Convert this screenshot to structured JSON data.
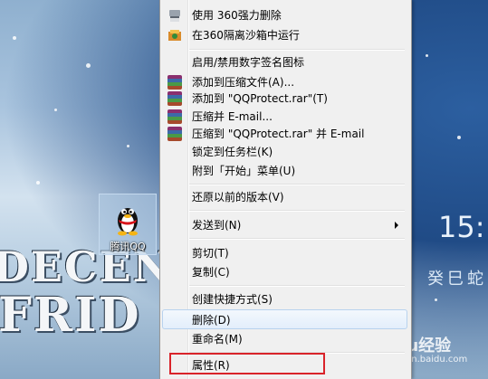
{
  "desktop": {
    "icon_label": "腾讯QQ",
    "banner_line1": "DECEN",
    "banner_line2": "FRID",
    "clock_text": "15:",
    "date_text": "癸巳蛇",
    "watermark": "Baidu经验",
    "watermark_sub": "jingyan.baidu.com"
  },
  "context_menu": {
    "items": [
      {
        "label": "使用 360强力删除",
        "icon": "shredder-icon"
      },
      {
        "label": "在360隔离沙箱中运行",
        "icon": "sandbox-icon"
      },
      {
        "label": "启用/禁用数字签名图标",
        "icon": ""
      },
      {
        "label": "添加到压缩文件(A)...",
        "icon": "winrar-icon"
      },
      {
        "label": "添加到 \"QQProtect.rar\"(T)",
        "icon": "winrar-icon"
      },
      {
        "label": "压缩并 E-mail...",
        "icon": "winrar-icon"
      },
      {
        "label": "压缩到 \"QQProtect.rar\" 并 E-mail",
        "icon": "winrar-icon"
      },
      {
        "label": "锁定到任务栏(K)",
        "icon": ""
      },
      {
        "label": "附到「开始」菜单(U)",
        "icon": ""
      },
      {
        "label": "还原以前的版本(V)",
        "icon": ""
      },
      {
        "label": "发送到(N)",
        "icon": "submenu-arrow-icon"
      },
      {
        "label": "剪切(T)",
        "icon": ""
      },
      {
        "label": "复制(C)",
        "icon": ""
      },
      {
        "label": "创建快捷方式(S)",
        "icon": ""
      },
      {
        "label": "删除(D)",
        "icon": ""
      },
      {
        "label": "重命名(M)",
        "icon": ""
      },
      {
        "label": "属性(R)",
        "icon": ""
      }
    ],
    "hovered_item": "删除(D)",
    "highlighted_item": "属性(R)",
    "highlight_color": "#d9232a"
  }
}
